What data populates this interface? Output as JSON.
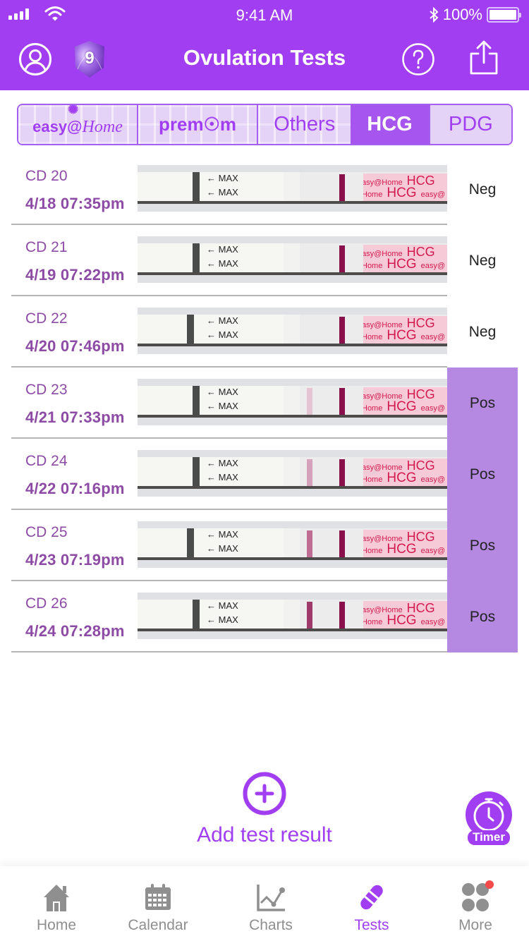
{
  "status_bar": {
    "time": "9:41 AM",
    "battery": "100%",
    "signal_icon": "cellular-signal-icon",
    "wifi_icon": "wifi-icon",
    "bluetooth_icon": "bluetooth-icon"
  },
  "header": {
    "title": "Ovulation Tests",
    "badge_level": "9",
    "profile_icon": "profile-icon",
    "help_icon": "help-icon",
    "share_icon": "share-icon"
  },
  "brand_tabs": [
    {
      "label": "easy@Home",
      "logo": "easy@Home",
      "active": false
    },
    {
      "label": "premom",
      "logo": "premom",
      "active": false
    },
    {
      "label": "Others",
      "active": false
    },
    {
      "label": "HCG",
      "active": true
    },
    {
      "label": "PDG",
      "active": false
    }
  ],
  "brand_logo_text": {
    "easy_prefix": "easy@",
    "easy_home": "Home",
    "premom": "prem☉m"
  },
  "strip": {
    "max_label": "← MAX",
    "brand_line1": "asy@Home",
    "brand_hcg": "HCG",
    "brand_line2_prefix": "Home",
    "brand_line2_suffix": "easy@",
    "control_line_color": "#8a104c"
  },
  "tests": [
    {
      "cd": "CD 20",
      "date": "4/18",
      "time": "07:35pm",
      "result": "Neg",
      "test_line_color": null
    },
    {
      "cd": "CD 21",
      "date": "4/19",
      "time": "07:22pm",
      "result": "Neg",
      "test_line_color": null
    },
    {
      "cd": "CD 22",
      "date": "4/20",
      "time": "07:46pm",
      "result": "Neg",
      "test_line_color": null
    },
    {
      "cd": "CD 23",
      "date": "4/21",
      "time": "07:33pm",
      "result": "Pos",
      "test_line_color": "#e4c3d2"
    },
    {
      "cd": "CD 24",
      "date": "4/22",
      "time": "07:16pm",
      "result": "Pos",
      "test_line_color": "#d6a2bb"
    },
    {
      "cd": "CD 25",
      "date": "4/23",
      "time": "07:19pm",
      "result": "Pos",
      "test_line_color": "#c06d93"
    },
    {
      "cd": "CD 26",
      "date": "4/24",
      "time": "07:28pm",
      "result": "Pos",
      "test_line_color": "#9e3969"
    }
  ],
  "add_test": {
    "label": "Add test result",
    "icon": "add-circle-icon"
  },
  "timer": {
    "label": "Timer",
    "icon": "stopwatch-icon"
  },
  "tab_bar": [
    {
      "label": "Home",
      "icon": "home-icon",
      "active": false
    },
    {
      "label": "Calendar",
      "icon": "calendar-icon",
      "active": false
    },
    {
      "label": "Charts",
      "icon": "chart-icon",
      "active": false
    },
    {
      "label": "Tests",
      "icon": "test-strip-icon",
      "active": true
    },
    {
      "label": "More",
      "icon": "more-icon",
      "active": false,
      "notification_dot": true
    }
  ],
  "colors": {
    "brand_purple": "#a13ef2",
    "positive_bg": "#b589e1",
    "date_text": "#8d4ba5",
    "tab_inactive": "#8f8f8f",
    "notification_dot": "#f44a4a"
  }
}
